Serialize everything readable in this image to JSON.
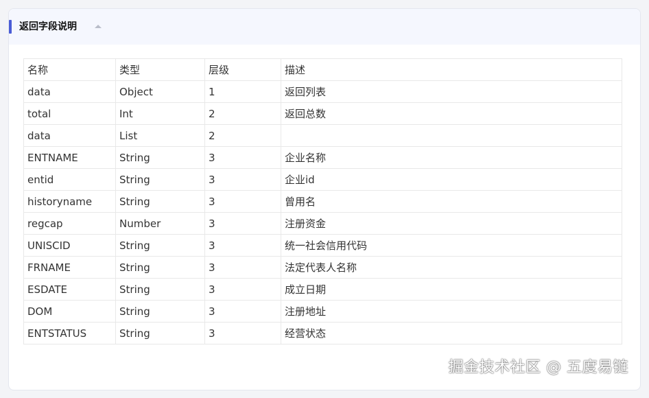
{
  "section": {
    "title": "返回字段说明",
    "toggle_icon": "caret-up-icon",
    "accent_color": "#4a5cd6"
  },
  "table": {
    "headers": [
      "名称",
      "类型",
      "层级",
      "描述"
    ],
    "rows": [
      [
        "data",
        "Object",
        "1",
        "返回列表"
      ],
      [
        "total",
        "Int",
        "2",
        "返回总数"
      ],
      [
        "data",
        "List",
        "2",
        ""
      ],
      [
        "ENTNAME",
        "String",
        "3",
        "企业名称"
      ],
      [
        "entid",
        "String",
        "3",
        "企业id"
      ],
      [
        "historyname",
        "String",
        "3",
        "曾用名"
      ],
      [
        "regcap",
        "Number",
        "3",
        "注册资金"
      ],
      [
        "UNISCID",
        "String",
        "3",
        "统一社会信用代码"
      ],
      [
        "FRNAME",
        "String",
        "3",
        "法定代表人名称"
      ],
      [
        "ESDATE",
        "String",
        "3",
        "成立日期"
      ],
      [
        "DOM",
        "String",
        "3",
        "注册地址"
      ],
      [
        "ENTSTATUS",
        "String",
        "3",
        "经营状态"
      ]
    ]
  },
  "watermark": "掘金技术社区 @ 五度易链"
}
